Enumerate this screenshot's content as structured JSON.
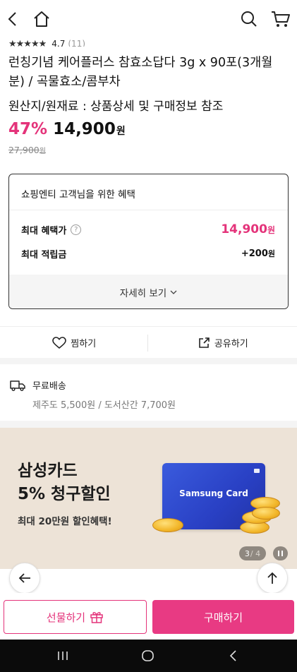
{
  "header": {
    "back_icon": "chevron-left-icon",
    "home_icon": "home-icon",
    "search_icon": "search-icon",
    "cart_icon": "cart-icon"
  },
  "product": {
    "stars": "★★★★★",
    "rating": "4.7",
    "review_count": "(11)",
    "title": "런칭기념 케어플러스 참효소답다 3g x 90포(3개월분) / 곡물효소/콤부차",
    "origin": "원산지/원재료 : 상품상세 및 구매정보 참조",
    "discount_rate": "47%",
    "price": "14,900",
    "price_unit": "원",
    "original_price": "27,900",
    "original_unit": "원"
  },
  "benefits": {
    "heading": "쇼핑엔티 고객님을 위한 혜택",
    "max_benefit_label": "최대 혜택가",
    "max_benefit_price": "14,900",
    "max_benefit_unit": "원",
    "max_points_label": "최대 적립금",
    "max_points_value": "+200",
    "max_points_unit": "원",
    "more_label": "자세히 보기"
  },
  "actions": {
    "wish_label": "찜하기",
    "share_label": "공유하기"
  },
  "shipping": {
    "label": "무료배송",
    "detail": "제주도 5,500원 / 도서산간 7,700원"
  },
  "banner": {
    "line1": "삼성카드",
    "line2": "5% 청구할인",
    "sub": "최대 20만원 할인혜택!",
    "card_name": "Samsung Card",
    "page_current": "3",
    "page_total": "/ 4",
    "colors": {
      "background": "#ede3d7",
      "card": "#2940c4"
    }
  },
  "bottom": {
    "gift_label": "선물하기",
    "buy_label": "구매하기",
    "colors": {
      "accent": "#e4337a",
      "buy_bg": "#e83a83"
    }
  }
}
